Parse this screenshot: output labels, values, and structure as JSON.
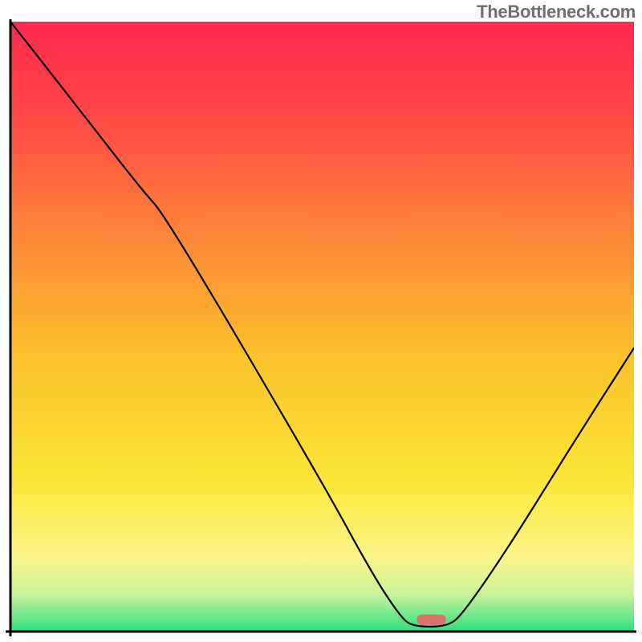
{
  "watermark": "TheBottleneck.com",
  "chart_data": {
    "type": "line",
    "title": "",
    "xlabel": "",
    "ylabel": "",
    "xlim": [
      0,
      100
    ],
    "ylim": [
      0,
      100
    ],
    "series": [
      {
        "name": "curve",
        "points": [
          [
            0.0,
            100.0
          ],
          [
            10.0,
            87.0
          ],
          [
            21.0,
            72.5
          ],
          [
            25.0,
            68.0
          ],
          [
            50.0,
            24.5
          ],
          [
            58.0,
            9.5
          ],
          [
            62.5,
            2.5
          ],
          [
            64.5,
            0.8
          ],
          [
            70.0,
            0.8
          ],
          [
            72.5,
            2.8
          ],
          [
            80.0,
            14.0
          ],
          [
            90.0,
            30.5
          ],
          [
            100.0,
            46.5
          ]
        ]
      }
    ],
    "marker": {
      "x": 67.5,
      "y": 2.0
    },
    "gradient_stops": [
      {
        "offset": 0.0,
        "color": "#ff2a4f"
      },
      {
        "offset": 0.15,
        "color": "#ff4747"
      },
      {
        "offset": 0.35,
        "color": "#fd8638"
      },
      {
        "offset": 0.55,
        "color": "#fbc22b"
      },
      {
        "offset": 0.75,
        "color": "#fae636"
      },
      {
        "offset": 0.88,
        "color": "#fbf58b"
      },
      {
        "offset": 0.94,
        "color": "#c9f29a"
      },
      {
        "offset": 1.0,
        "color": "#29e07e"
      }
    ],
    "axis_color": "#000000",
    "marker_color": "#d9726d"
  }
}
